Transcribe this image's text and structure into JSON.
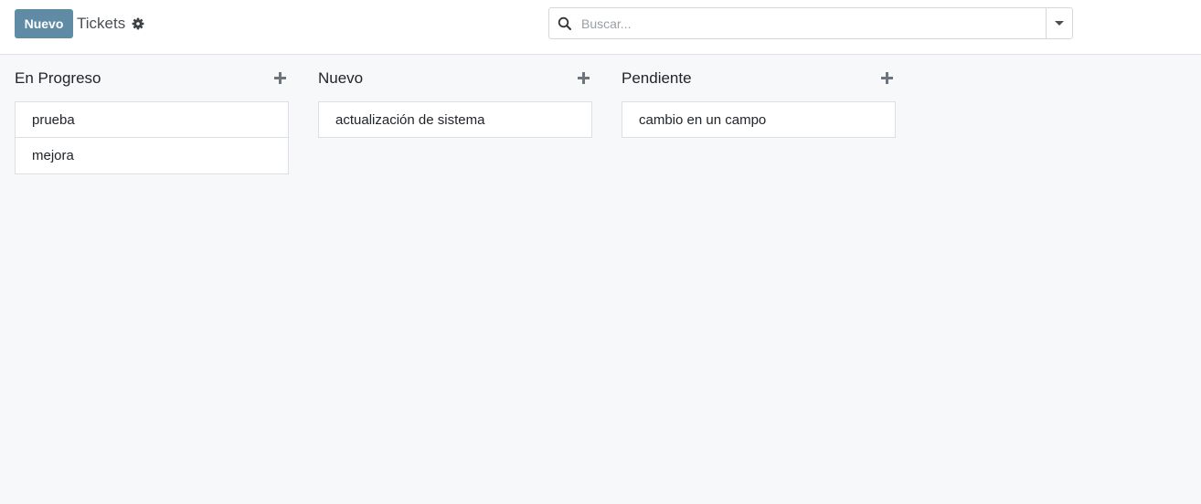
{
  "control_panel": {
    "new_button_label": "Nuevo",
    "breadcrumb_title": "Tickets",
    "search_placeholder": "Buscar..."
  },
  "kanban": {
    "columns": [
      {
        "title": "En Progreso",
        "cards": [
          "prueba",
          "mejora"
        ]
      },
      {
        "title": "Nuevo",
        "cards": [
          "actualización de sistema"
        ]
      },
      {
        "title": "Pendiente",
        "cards": [
          "cambio en un campo"
        ]
      }
    ]
  },
  "colors": {
    "primary": "#5f8ba5",
    "background": "#f7f8fa"
  }
}
